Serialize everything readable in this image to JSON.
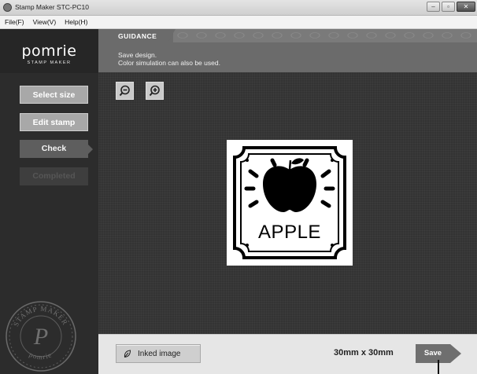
{
  "window": {
    "title": "Stamp Maker STC-PC10",
    "controls": [
      "minimize-icon",
      "maximize-icon",
      "close-icon"
    ]
  },
  "menu": {
    "items": [
      "File(F)",
      "View(V)",
      "Help(H)"
    ]
  },
  "logo": {
    "brand": "pomrie",
    "tagline": "STAMP MAKER",
    "seal_text": [
      "STAMP MAKER",
      "P",
      "pomrie"
    ]
  },
  "steps": [
    {
      "label": "Select size",
      "state": "done"
    },
    {
      "label": "Edit stamp",
      "state": "done"
    },
    {
      "label": "Check",
      "state": "current"
    },
    {
      "label": "Completed",
      "state": "disabled"
    }
  ],
  "guidance": {
    "label": "GUIDANCE",
    "line1": "Save design.",
    "line2": "Color simulation can also be used."
  },
  "zoom": {
    "out_icon": "zoom-out-icon",
    "in_icon": "zoom-in-icon"
  },
  "stamp": {
    "text": "APPLE",
    "graphic": "apple-icon"
  },
  "footer": {
    "inked_button": "Inked image",
    "inked_icon": "leaf-icon",
    "size": "30mm x 30mm",
    "save_button": "Save"
  },
  "colors": {
    "sidebar": "#262626",
    "guidance_bg": "#6b6b6b",
    "canvas_bg": "#333333",
    "button_done": "#a8a8a8",
    "button_current": "#5e5e5e",
    "save_button": "#6f6f6f"
  }
}
